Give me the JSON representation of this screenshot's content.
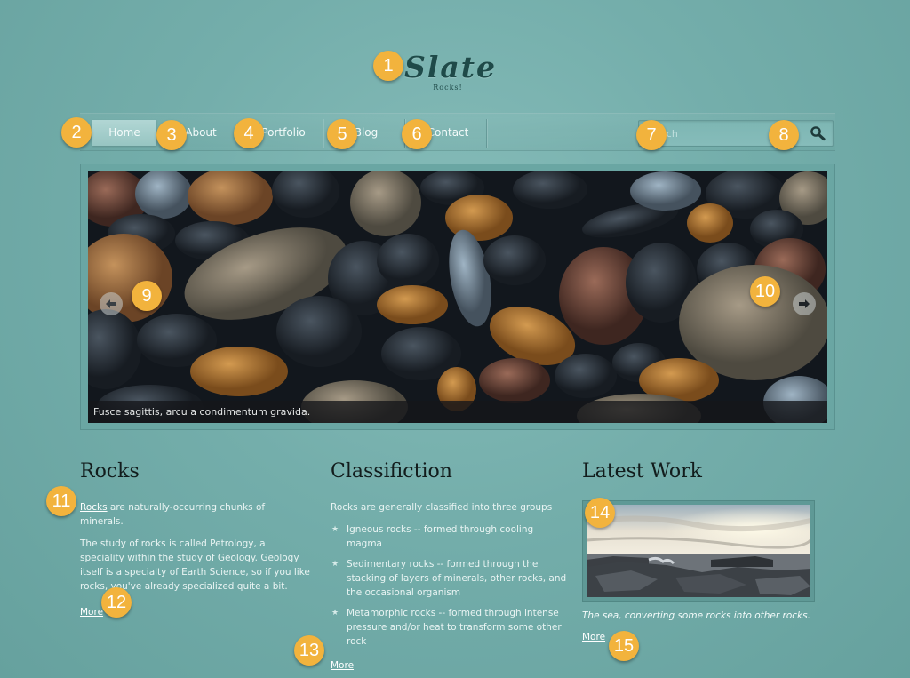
{
  "header": {
    "title": "Slate",
    "tagline": "Rocks!"
  },
  "nav": {
    "items": [
      {
        "label": "Home",
        "active": true
      },
      {
        "label": "About",
        "active": false
      },
      {
        "label": "Portfolio",
        "active": false
      },
      {
        "label": "Blog",
        "active": false
      },
      {
        "label": "Contact",
        "active": false
      }
    ],
    "search_placeholder": "Search",
    "search_icon": "magnifier-icon"
  },
  "slider": {
    "caption": "Fusce sagittis, arcu a condimentum gravida.",
    "prev_icon": "arrow-left-icon",
    "next_icon": "arrow-right-icon"
  },
  "columns": {
    "rocks": {
      "heading": "Rocks",
      "link_word": "Rocks",
      "intro_rest": " are naturally-occurring chunks of minerals.",
      "body": "The study of rocks is called Petrology, a speciality within the study of Geology. Geology itself is a specialty of Earth Science, so if you like rocks, you've already specialized quite a bit.",
      "more": "More"
    },
    "classification": {
      "heading": "Classifiction",
      "intro": "Rocks are generally classified into three groups",
      "items": [
        "Igneous rocks -- formed through cooling magma",
        "Sedimentary rocks -- formed through the stacking of layers of minerals, other rocks, and the occasional organism",
        "Metamorphic rocks -- formed through intense pressure and/or heat to transform some other rock"
      ],
      "more": "More"
    },
    "latest": {
      "heading": "Latest Work",
      "caption": "The sea, converting some rocks into other rocks.",
      "more": "More"
    }
  },
  "badges": [
    "1",
    "2",
    "3",
    "4",
    "5",
    "6",
    "7",
    "8",
    "9",
    "10",
    "11",
    "12",
    "13",
    "14",
    "15"
  ],
  "colors": {
    "background": "#74aeab",
    "badge": "#f2b33d",
    "heading": "#121c1c",
    "logo": "#1f4a49"
  }
}
